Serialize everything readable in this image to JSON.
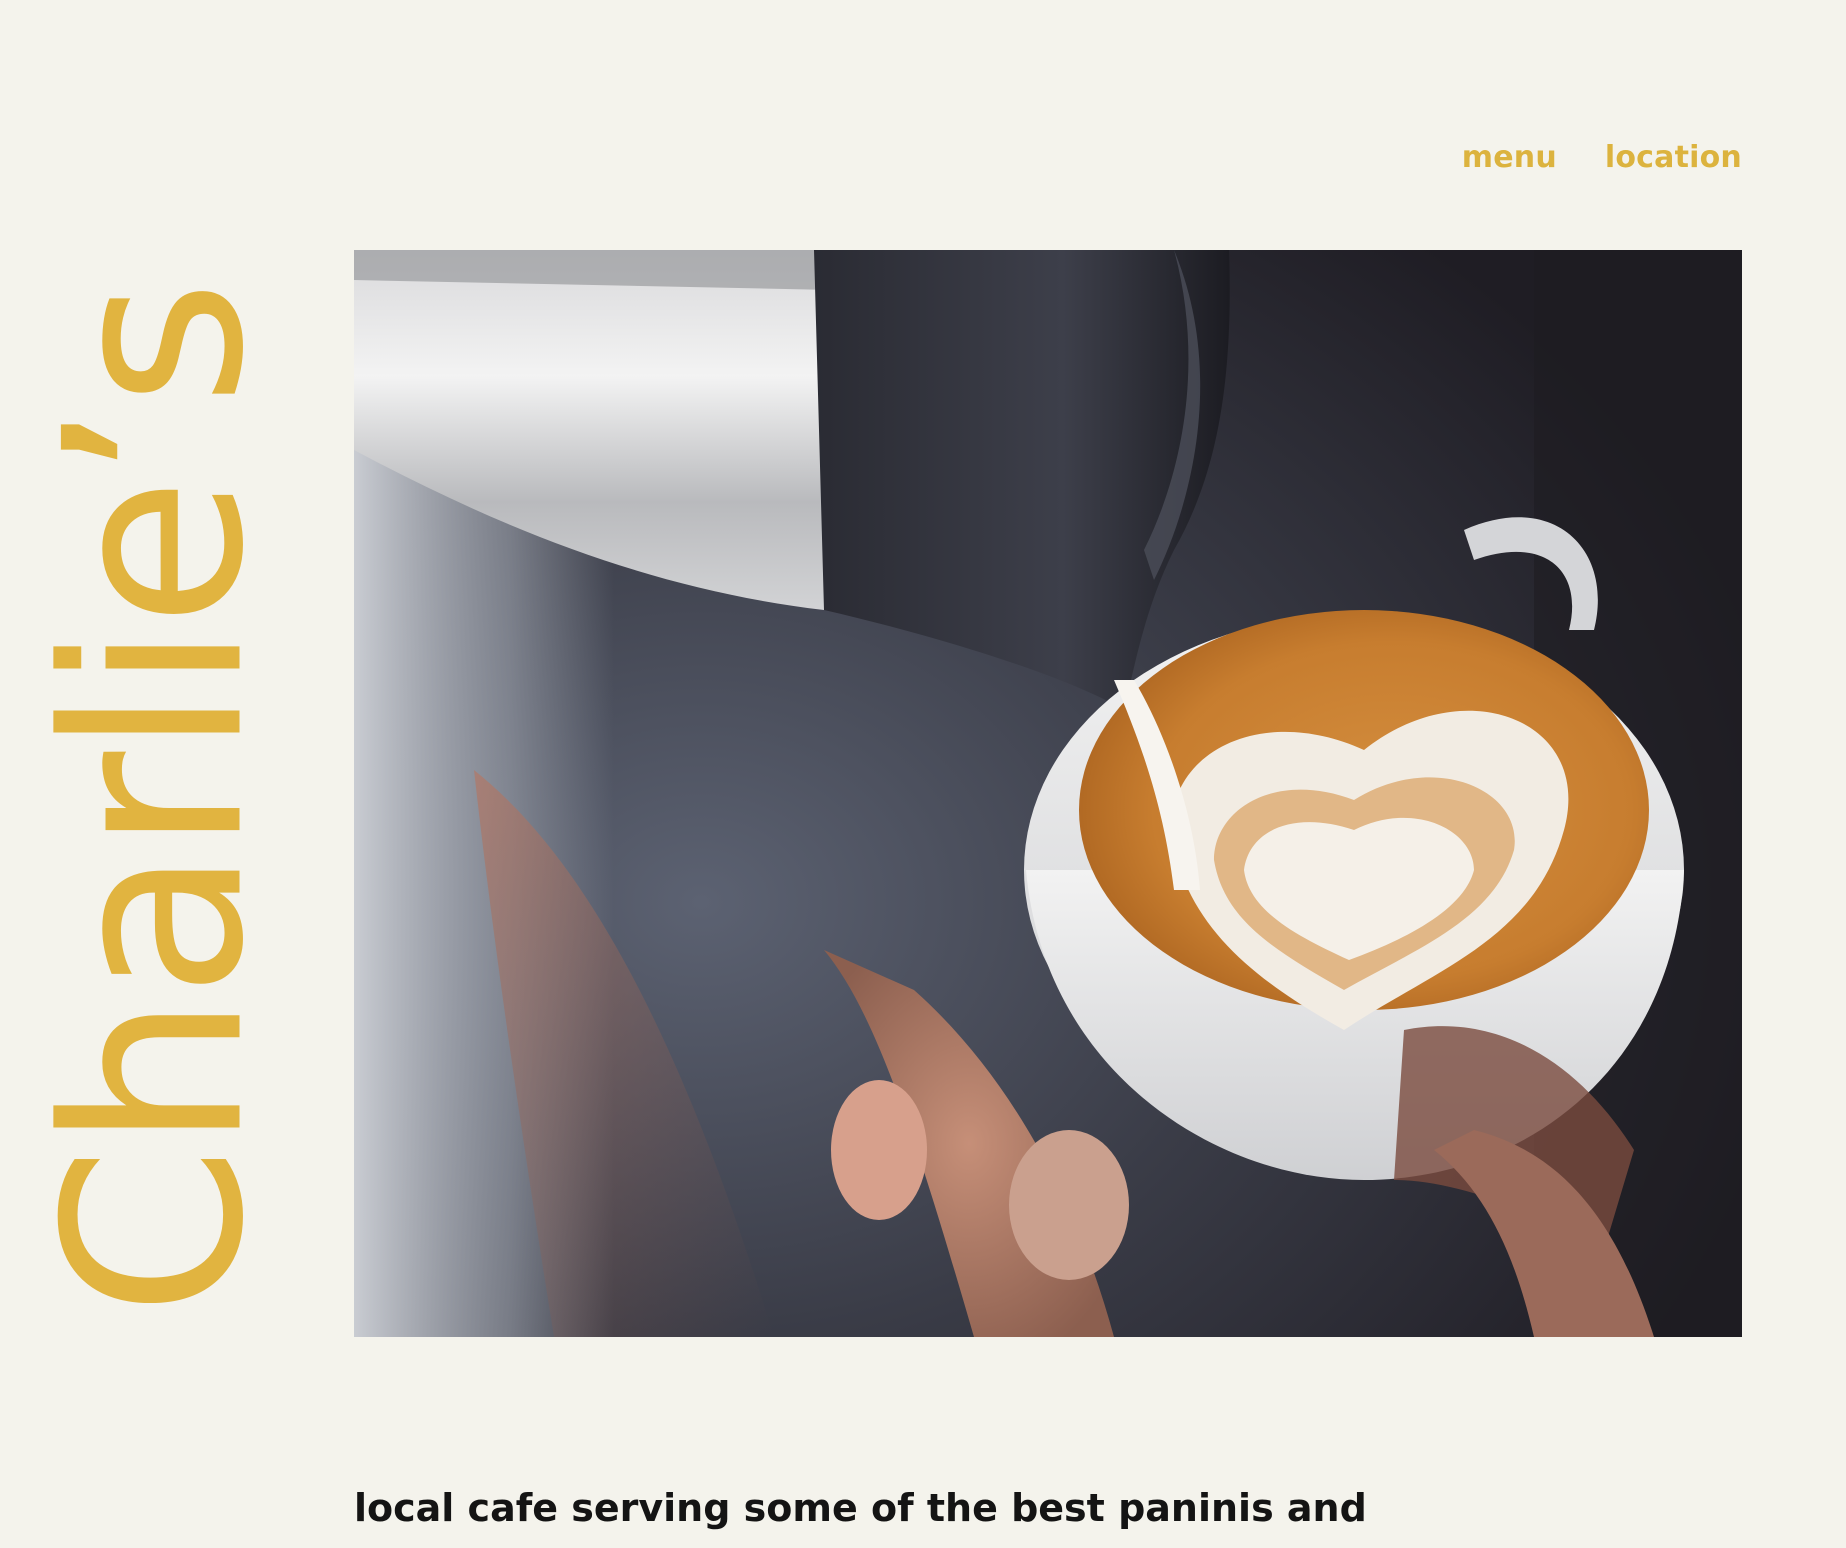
{
  "brand": {
    "name": "Charlie’s"
  },
  "nav": {
    "items": [
      {
        "label": "menu"
      },
      {
        "label": "location"
      }
    ]
  },
  "hero": {
    "image_subject": "latte-art-pour-photo"
  },
  "tagline": "local cafe serving some of the best paninis and",
  "colors": {
    "accent": "#e1b440",
    "background": "#f4f3ec",
    "text": "#141414"
  }
}
